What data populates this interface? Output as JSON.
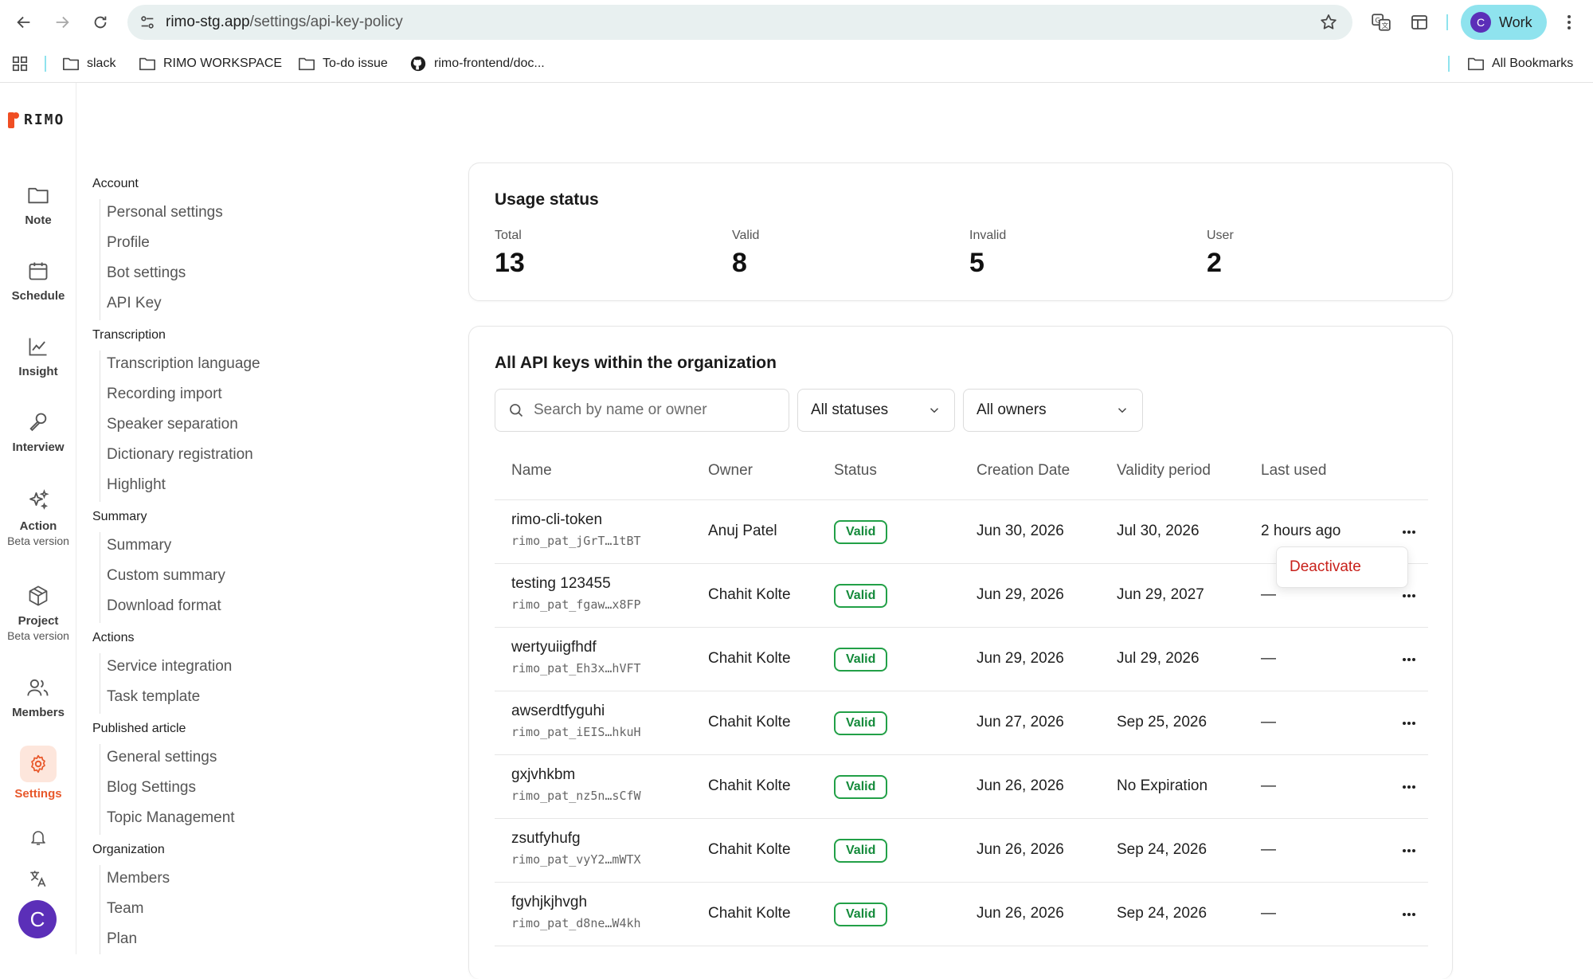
{
  "browser": {
    "url_host": "rimo-stg.app",
    "url_path": "/settings/api-key-policy",
    "profile_initial": "C",
    "profile_name": "Work",
    "bookmarks": [
      "slack",
      "RIMO WORKSPACE",
      "To-do issue",
      "rimo-frontend/doc..."
    ],
    "all_bookmarks": "All Bookmarks"
  },
  "app": {
    "logo_text": "RIMO",
    "accent": "#e8582b",
    "rail": [
      {
        "label": "Note",
        "icon": "folder-icon"
      },
      {
        "label": "Schedule",
        "icon": "calendar-icon"
      },
      {
        "label": "Insight",
        "icon": "chart-icon"
      },
      {
        "label": "Interview",
        "icon": "microphone-icon"
      },
      {
        "label": "Action",
        "sub": "Beta version",
        "icon": "sparkle-icon"
      },
      {
        "label": "Project",
        "sub": "Beta version",
        "icon": "package-icon"
      },
      {
        "label": "Members",
        "icon": "users-icon"
      },
      {
        "label": "Settings",
        "icon": "gear-icon"
      }
    ],
    "user_initial": "C"
  },
  "settings_nav": {
    "account": "Account",
    "account_items": [
      "Personal settings",
      "Profile",
      "Bot settings",
      "API Key"
    ],
    "transcription": "Transcription",
    "transcription_items": [
      "Transcription language",
      "Recording import",
      "Speaker separation",
      "Dictionary registration",
      "Highlight"
    ],
    "summary": "Summary",
    "summary_items": [
      "Summary",
      "Custom summary",
      "Download format"
    ],
    "actions": "Actions",
    "actions_items": [
      "Service integration",
      "Task template"
    ],
    "published": "Published article",
    "published_items": [
      "General settings",
      "Blog Settings",
      "Topic Management"
    ],
    "organization": "Organization",
    "organization_items": [
      "Members",
      "Team",
      "Plan"
    ]
  },
  "usage": {
    "title": "Usage status",
    "stats": [
      {
        "label": "Total",
        "value": "13"
      },
      {
        "label": "Valid",
        "value": "8"
      },
      {
        "label": "Invalid",
        "value": "5"
      },
      {
        "label": "User",
        "value": "2"
      }
    ]
  },
  "keys": {
    "title": "All API keys within the organization",
    "search_placeholder": "Search by name or owner",
    "status_filter": "All statuses",
    "owner_filter": "All owners",
    "columns": [
      "Name",
      "Owner",
      "Status",
      "Creation Date",
      "Validity period",
      "Last used"
    ],
    "rows": [
      {
        "name": "rimo-cli-token",
        "key": "rimo_pat_jGrT…1tBT",
        "owner": "Anuj Patel",
        "status": "Valid",
        "created": "Jun 30, 2026",
        "validity": "Jul 30, 2026",
        "last_used": "2 hours ago"
      },
      {
        "name": "testing 123455",
        "key": "rimo_pat_fgaw…x8FP",
        "owner": "Chahit Kolte",
        "status": "Valid",
        "created": "Jun 29, 2026",
        "validity": "Jun 29, 2027",
        "last_used": "—"
      },
      {
        "name": "wertyuiigfhdf",
        "key": "rimo_pat_Eh3x…hVFT",
        "owner": "Chahit Kolte",
        "status": "Valid",
        "created": "Jun 29, 2026",
        "validity": "Jul 29, 2026",
        "last_used": "—"
      },
      {
        "name": "awserdtfyguhi",
        "key": "rimo_pat_iEIS…hkuH",
        "owner": "Chahit Kolte",
        "status": "Valid",
        "created": "Jun 27, 2026",
        "validity": "Sep 25, 2026",
        "last_used": "—"
      },
      {
        "name": "gxjvhkbm",
        "key": "rimo_pat_nz5n…sCfW",
        "owner": "Chahit Kolte",
        "status": "Valid",
        "created": "Jun 26, 2026",
        "validity": "No Expiration",
        "last_used": "—"
      },
      {
        "name": "zsutfyhufg",
        "key": "rimo_pat_vyY2…mWTX",
        "owner": "Chahit Kolte",
        "status": "Valid",
        "created": "Jun 26, 2026",
        "validity": "Sep 24, 2026",
        "last_used": "—"
      },
      {
        "name": "fgvhjkjhvgh",
        "key": "rimo_pat_d8ne…W4kh",
        "owner": "Chahit Kolte",
        "status": "Valid",
        "created": "Jun 26, 2026",
        "validity": "Sep 24, 2026",
        "last_used": "—"
      }
    ],
    "menu_deactivate": "Deactivate",
    "status_color": "#22a047"
  }
}
